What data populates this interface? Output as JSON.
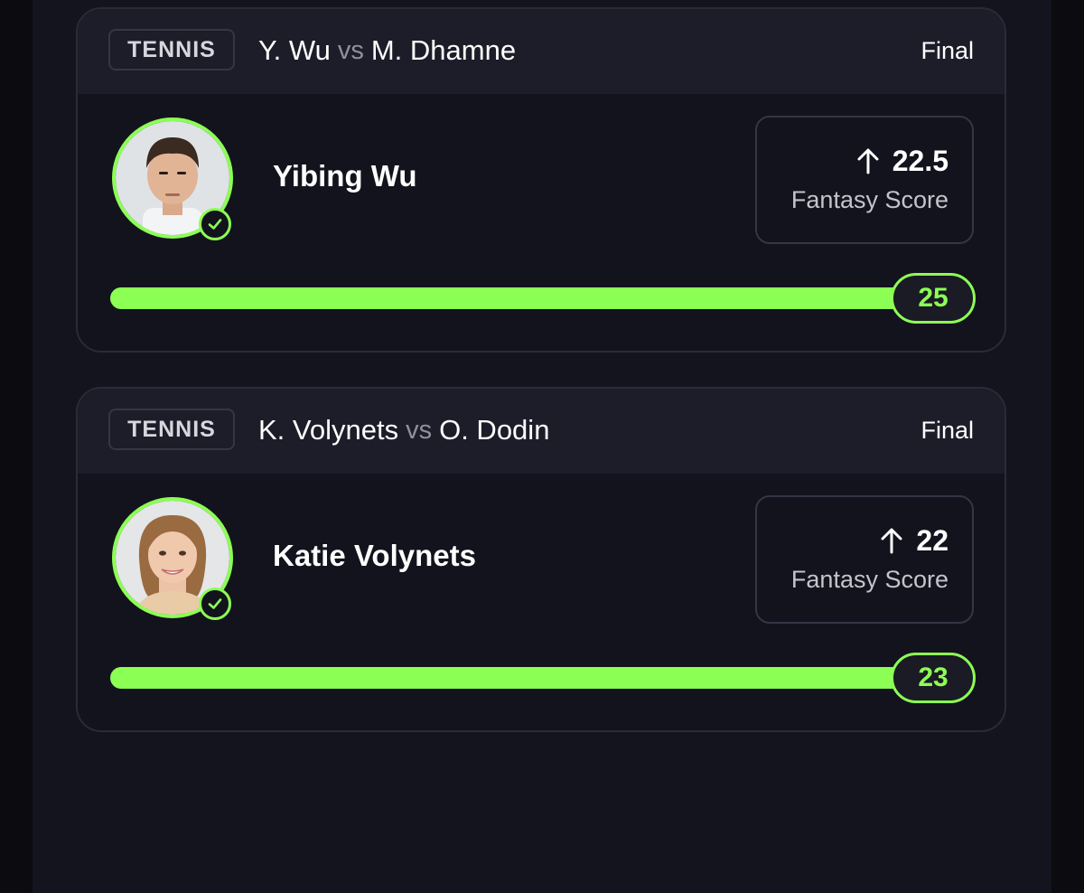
{
  "colors": {
    "accent": "#8cff54",
    "background": "#0b0b10",
    "card": "#12131d",
    "card_header": "#1c1d29"
  },
  "cards": [
    {
      "sport": "TENNIS",
      "player1": "Y. Wu",
      "vs": "vs",
      "player2": "M. Dhamne",
      "status": "Final",
      "player_name": "Yibing Wu",
      "direction_icon": "arrow-up-icon",
      "score": "22.5",
      "score_label": "Fantasy Score",
      "line": "25",
      "progress": 1.0,
      "avatar_icon": "player-photo"
    },
    {
      "sport": "TENNIS",
      "player1": "K. Volynets",
      "vs": "vs",
      "player2": "O. Dodin",
      "status": "Final",
      "player_name": "Katie Volynets",
      "direction_icon": "arrow-up-icon",
      "score": "22",
      "score_label": "Fantasy Score",
      "line": "23",
      "progress": 1.0,
      "avatar_icon": "player-photo"
    }
  ]
}
